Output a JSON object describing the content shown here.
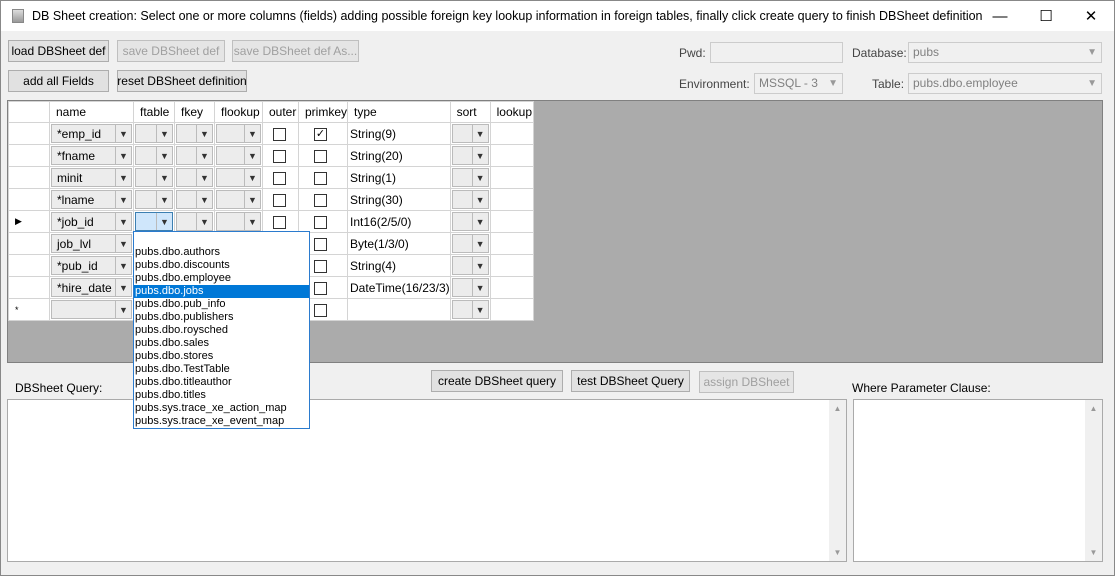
{
  "window": {
    "title": "DB Sheet creation: Select one or more columns (fields) adding possible foreign key lookup information in foreign tables, finally click create query to finish DBSheet definition",
    "min_glyph": "—",
    "max_glyph": "☐",
    "close_glyph": "✕"
  },
  "toolbar": {
    "load_label": "load DBSheet def",
    "save_label": "save DBSheet def",
    "save_as_label": "save DBSheet def As...",
    "add_all_label": "add all Fields",
    "reset_label": "reset DBSheet definition"
  },
  "connection": {
    "pwd_label": "Pwd:",
    "pwd_value": "",
    "database_label": "Database:",
    "database_value": "pubs",
    "environment_label": "Environment:",
    "environment_value": "MSSQL - 3",
    "table_label": "Table:",
    "table_value": "pubs.dbo.employee"
  },
  "grid": {
    "headers": {
      "name": "name",
      "ftable": "ftable",
      "fkey": "fkey",
      "flookup": "flookup",
      "outer": "outer",
      "primkey": "primkey",
      "type": "type",
      "sort": "sort",
      "lookup": "lookup"
    },
    "rows": [
      {
        "name": "*emp_id",
        "type": "String(9)",
        "primkey": true
      },
      {
        "name": "*fname",
        "type": "String(20)",
        "primkey": false
      },
      {
        "name": "minit",
        "type": "String(1)",
        "primkey": false
      },
      {
        "name": "*lname",
        "type": "String(30)",
        "primkey": false
      },
      {
        "name": "*job_id",
        "type": "Int16(2/5/0)",
        "primkey": false,
        "current": true
      },
      {
        "name": "job_lvl",
        "type": "Byte(1/3/0)",
        "primkey": false
      },
      {
        "name": "*pub_id",
        "type": "String(4)",
        "primkey": false
      },
      {
        "name": "*hire_date",
        "type": "DateTime(16/23/3)",
        "primkey": false
      }
    ],
    "current_row_marker": "▶",
    "new_row_marker": "*",
    "check_mark": "✓",
    "dropdown_arrow": "▼"
  },
  "ftable_dropdown": {
    "options": [
      "pubs.dbo.authors",
      "pubs.dbo.discounts",
      "pubs.dbo.employee",
      "pubs.dbo.jobs",
      "pubs.dbo.pub_info",
      "pubs.dbo.publishers",
      "pubs.dbo.roysched",
      "pubs.dbo.sales",
      "pubs.dbo.stores",
      "pubs.dbo.TestTable",
      "pubs.dbo.titleauthor",
      "pubs.dbo.titles",
      "pubs.sys.trace_xe_action_map",
      "pubs.sys.trace_xe_event_map"
    ],
    "selected": "pubs.dbo.jobs"
  },
  "query": {
    "label": "DBSheet Query:",
    "create_label": "create DBSheet query",
    "test_label": "test DBSheet Query",
    "assign_label": "assign DBSheet",
    "where_label": "Where Parameter Clause:",
    "text": "",
    "where_text": ""
  },
  "colors": {
    "selection": "#0078d7",
    "grid_background": "#ababab",
    "dropdown_border": "#2b7bce"
  }
}
